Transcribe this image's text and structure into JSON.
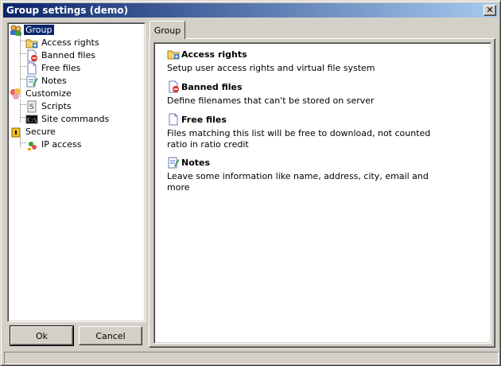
{
  "window": {
    "title": "Group settings (demo)",
    "close_glyph": "✕"
  },
  "tree": {
    "group": "Group",
    "access_rights": "Access rights",
    "banned_files": "Banned files",
    "free_files": "Free files",
    "notes": "Notes",
    "customize": "Customize",
    "scripts": "Scripts",
    "site_commands": "Site commands",
    "secure": "Secure",
    "ip_access": "IP access"
  },
  "buttons": {
    "ok": "Ok",
    "cancel": "Cancel"
  },
  "tab": {
    "label": "Group"
  },
  "sections": [
    {
      "title": "Access rights",
      "desc": "Setup user access rights and virtual file system",
      "icon": "folder-key-icon"
    },
    {
      "title": "Banned files",
      "desc": "Define filenames that can't be stored on server",
      "icon": "banned-file-icon"
    },
    {
      "title": "Free files",
      "desc": "Files matching this list will be free to download, not counted ratio in ratio credit",
      "icon": "file-icon"
    },
    {
      "title": "Notes",
      "desc": "Leave some information like name, address, city, email and more",
      "icon": "notes-icon"
    }
  ],
  "colors": {
    "selection": "#0a246a",
    "title_gradient_start": "#0a246a",
    "title_gradient_end": "#a6caf0",
    "face": "#d4d0c8"
  }
}
